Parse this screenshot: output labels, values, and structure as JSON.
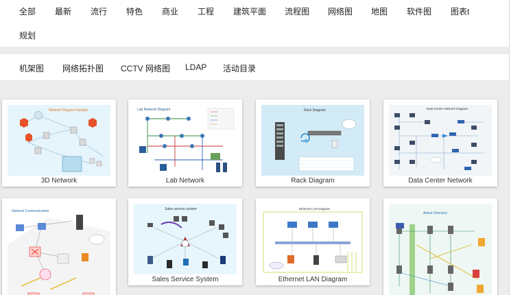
{
  "categories": [
    "全部",
    "最新",
    "流行",
    "特色",
    "商业",
    "工程",
    "建筑平面",
    "流程图",
    "网络图",
    "地图",
    "软件图",
    "图表t",
    "规划"
  ],
  "subcategories": [
    "机架图",
    "网络拓扑图",
    "CCTV 网络图",
    "LDAP",
    "活动目录"
  ],
  "cards": [
    {
      "label": "3D Network",
      "inner_title": "Network Diagram Sample"
    },
    {
      "label": "Lab Network",
      "inner_title": "Lab Network Diagram"
    },
    {
      "label": "Rack Diagram",
      "inner_title": "Rack Diagram"
    },
    {
      "label": "Data Center Network",
      "inner_title": "Data Center Network Diagram"
    },
    {
      "label": "",
      "inner_title": "Network Communication"
    },
    {
      "label": "Sales Service System",
      "inner_title": "Sales service system"
    },
    {
      "label": "Ethernet LAN Diagram",
      "inner_title": "Ethernet LAN Diagram"
    },
    {
      "label": "",
      "inner_title": "Active Directory"
    }
  ],
  "colors": {
    "page_bg": "#ececec",
    "bar_bg": "#ffffff",
    "card_bg": "#ffffff",
    "text": "#222222"
  }
}
